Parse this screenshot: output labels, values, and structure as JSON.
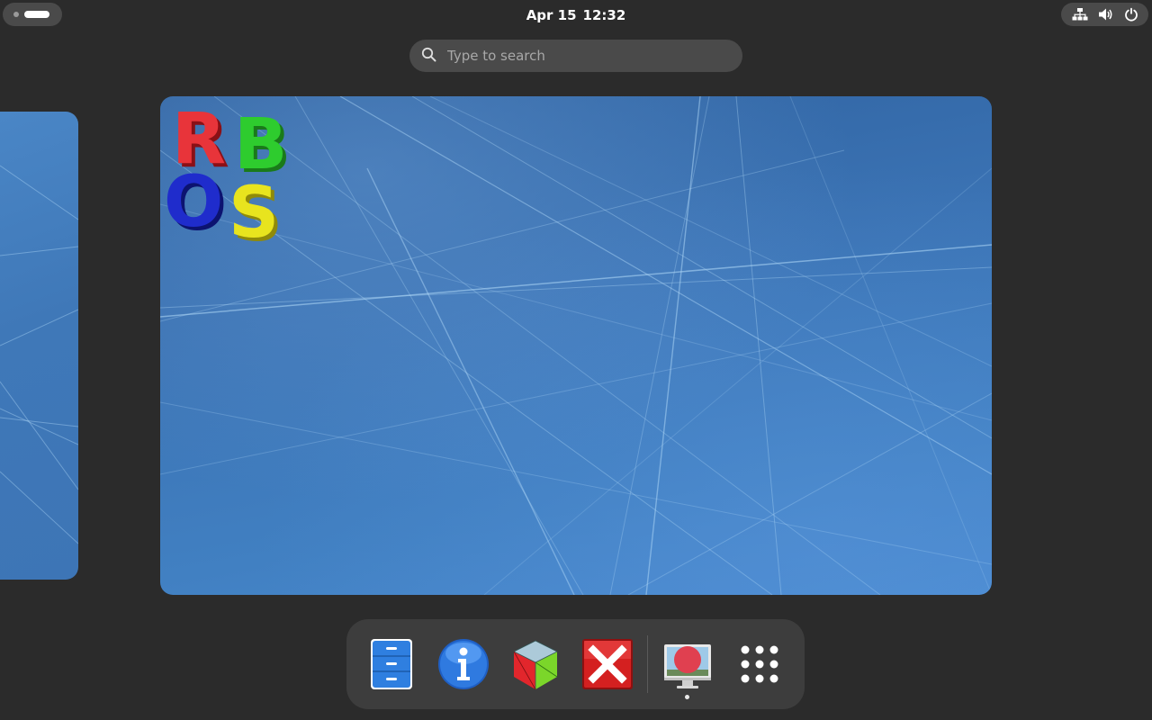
{
  "topbar": {
    "date": "Apr 15",
    "time": "12:32",
    "indicators": [
      "network-icon",
      "volume-icon",
      "power-icon"
    ]
  },
  "search": {
    "placeholder": "Type to search"
  },
  "workspace": {
    "logo_letters": [
      "R",
      "B",
      "O",
      "S"
    ],
    "colors": {
      "r": "#e8343a",
      "b": "#2ecc2e",
      "o": "#1f2ccc",
      "s": "#e8e41e"
    }
  },
  "dock": {
    "apps": [
      "file-manager-icon",
      "info-icon",
      "3d-cube-icon",
      "close-app-icon",
      "screen-recorder-icon"
    ],
    "app_grid": "show-apps-icon",
    "running": "screen-recorder-icon"
  },
  "colors": {
    "panel_bg": "#2b2b2b",
    "pill_bg": "#4a4a4a",
    "dock_bg": "#3d3d3d",
    "wallpaper_blue": "#3d75b6"
  }
}
